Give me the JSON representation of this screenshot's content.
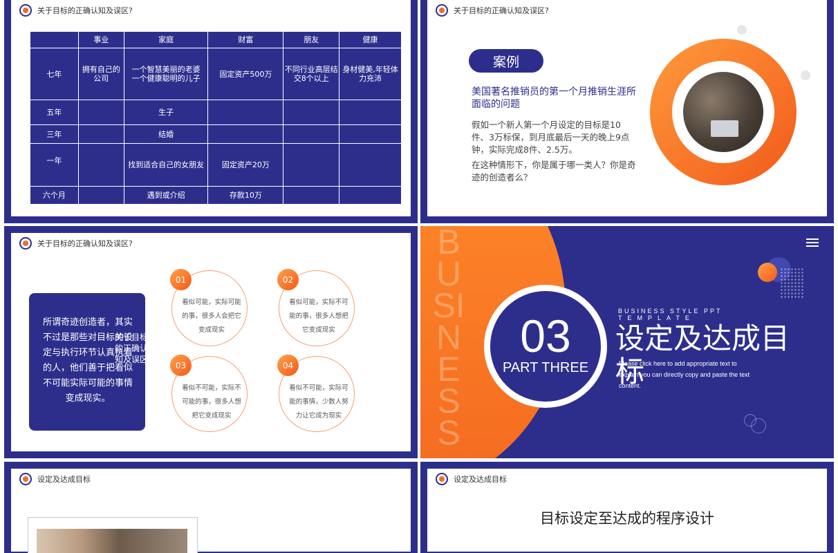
{
  "slides": {
    "s1": {
      "header": "关于目标的正确认知及误区?",
      "columns": [
        "",
        "事业",
        "家庭",
        "财富",
        "朋友",
        "健康"
      ],
      "rows": [
        [
          "七年",
          "拥有自己的公司",
          "一个智慧美丽的老婆\n一个健康聪明的儿子",
          "固定资产500万",
          "不同行业高层结交8个以上",
          "身材健美,年轻体力充沛"
        ],
        [
          "五年",
          "",
          "生子",
          "",
          "",
          ""
        ],
        [
          "三年",
          "",
          "结婚",
          "",
          "",
          ""
        ],
        [
          "一年",
          "",
          "找到适合自己的女朋友",
          "固定资产20万",
          "",
          ""
        ],
        [
          "六个月",
          "",
          "遇到或介绍",
          "存款10万",
          "",
          ""
        ]
      ]
    },
    "s2": {
      "header": "关于目标的正确认知及误区?",
      "pill": "案例",
      "title": "美国著名推销员的第一个月推销生涯所面临的问题",
      "body1": "假如一个新人第一个月设定的目标是10件、3万标保，到月底最后一天的晚上9点钟，实际完成8件、2.5万。",
      "body2": "在这种情形下，你是属于哪一类人？你是奇迹的创造者么？"
    },
    "s3": {
      "header": "关于目标的正确认知及误区?",
      "quote": "所谓奇迹创造者，其实不过是那些对目标的设定与执行环节认真执着的人，他们善于把看似不可能实际可能的事情变成现实。",
      "overlap_text": "关于目标的正确认知及误区",
      "cards": [
        {
          "num": "01",
          "text": "看似可能，实际可能的事，很多人会把它变成现实"
        },
        {
          "num": "02",
          "text": "看似可能，实际不可能的事，很多人想把它变成现实"
        },
        {
          "num": "03",
          "text": "看似不可能，实际不可能的事，很多人想把它变成现实"
        },
        {
          "num": "04",
          "text": "看似不可能，实际可能的事情，少数人努力让它成为现实"
        }
      ]
    },
    "s4": {
      "bg_word": "BUSINESS",
      "number": "03",
      "part": "PART THREE",
      "style_line1": "BUSINESS STYLE PPT",
      "style_line2": "TEMPLATE",
      "title": "设定及达成目标",
      "desc": "Please click here to add appropriate text to explain you can directly copy and paste the text content."
    },
    "s5": {
      "header": "设定及达成目标"
    },
    "s6": {
      "header": "设定及达成目标",
      "title": "目标设定至达成的程序设计"
    }
  },
  "colors": {
    "primary": "#2d2e8c",
    "accent": "#f26b2a"
  }
}
